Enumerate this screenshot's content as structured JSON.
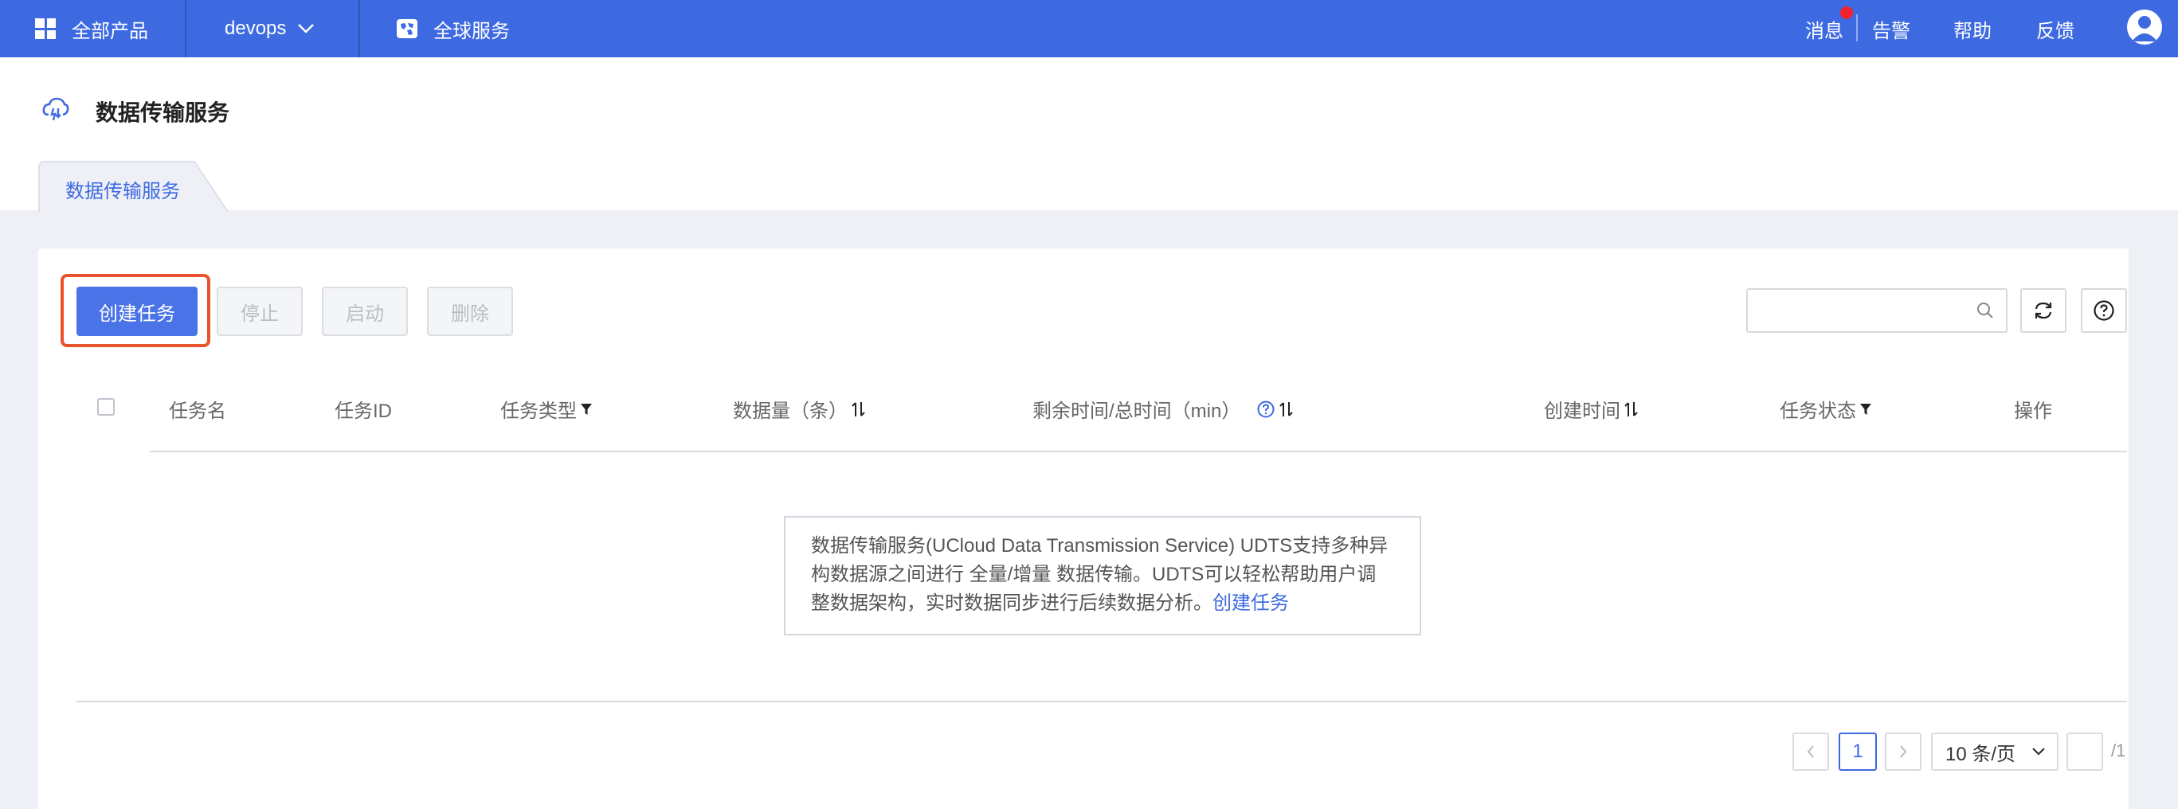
{
  "topbar": {
    "all_products": "全部产品",
    "project": "devops",
    "global_service": "全球服务",
    "messages": "消息",
    "alerts": "告警",
    "help": "帮助",
    "feedback": "反馈"
  },
  "header": {
    "title": "数据传输服务",
    "tab": "数据传输服务"
  },
  "toolbar": {
    "create": "创建任务",
    "stop": "停止",
    "start": "启动",
    "delete": "删除",
    "search_value": ""
  },
  "table": {
    "columns": [
      "任务名",
      "任务ID",
      "任务类型",
      "数据量（条）",
      "剩余时间/总时间（min）",
      "创建时间",
      "任务状态",
      "操作"
    ]
  },
  "empty": {
    "line1": "数据传输服务(UCloud Data Transmission Service) UDTS支持多种异",
    "line2": "构数据源之间进行 全量/增量 数据传输。UDTS可以轻松帮助用户调",
    "line3": "整数据架构，实时数据同步进行后续数据分析。",
    "link": "创建任务"
  },
  "pagination": {
    "current_page": "1",
    "page_size": "10 条/页",
    "jump_value": "",
    "total": "/1"
  },
  "colors": {
    "brand": "#3e6ae1",
    "primary_button": "#4a73e8",
    "highlight": "#e8532c",
    "badge": "#f5222d"
  }
}
